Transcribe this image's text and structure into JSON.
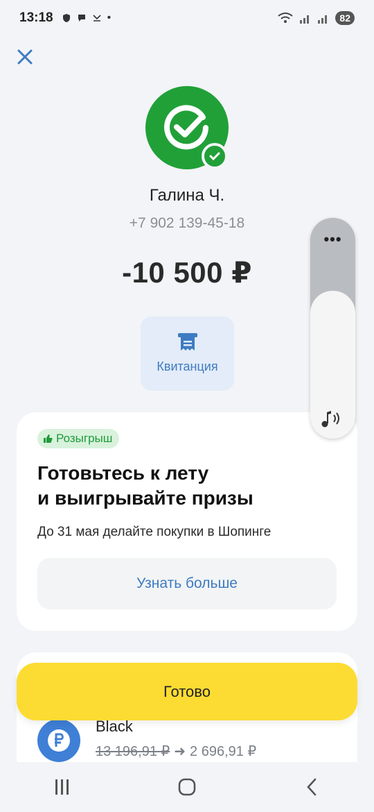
{
  "status": {
    "time": "13:18",
    "battery": "82"
  },
  "payment": {
    "recipient_name": "Галина Ч.",
    "recipient_phone": "+7 902 139-45-18",
    "amount": "-10 500 ₽",
    "receipt_label": "Квитанция"
  },
  "promo": {
    "badge": "Розыгрыш",
    "title_line1": "Готовьтесь к лету",
    "title_line2": "и выигрывайте призы",
    "subtitle": "До 31 мая делайте покупки в Шопинге",
    "more_button": "Узнать больше"
  },
  "account": {
    "name": "Black",
    "old_balance": "13 196,91 ₽",
    "arrow": "➜",
    "new_balance": "2 696,91 ₽"
  },
  "done_button": "Готово",
  "volume": {
    "dots": "•••",
    "level": 0.67
  },
  "colors": {
    "accent_green": "#21a038",
    "link_blue": "#3e7bc2",
    "done_yellow": "#fcdc32"
  }
}
